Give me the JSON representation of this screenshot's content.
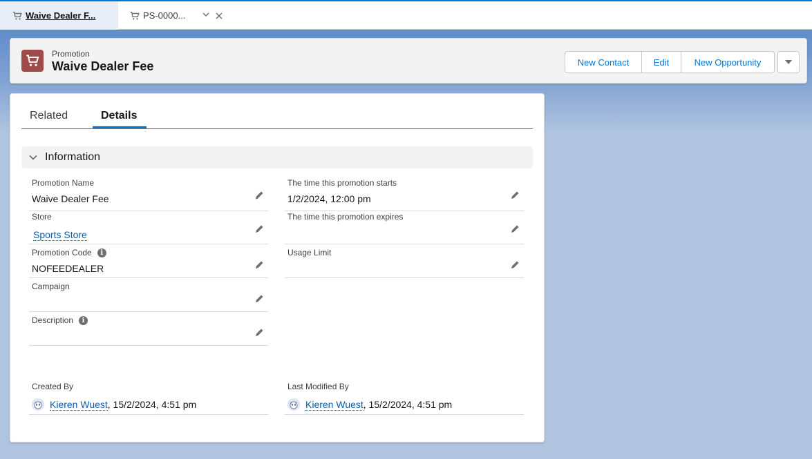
{
  "tabs": [
    {
      "label": "Waive Dealer F..."
    },
    {
      "label": "PS-0000..."
    }
  ],
  "header": {
    "object_type": "Promotion",
    "record_name": "Waive Dealer Fee",
    "buttons": {
      "new_contact": "New Contact",
      "edit": "Edit",
      "new_opportunity": "New Opportunity"
    }
  },
  "record_tabs": {
    "related": "Related",
    "details": "Details"
  },
  "section": {
    "title": "Information"
  },
  "fields": {
    "promotion_name": {
      "label": "Promotion Name",
      "value": "Waive Dealer Fee"
    },
    "starts": {
      "label": "The time this promotion starts",
      "value": "1/2/2024, 12:00 pm"
    },
    "store": {
      "label": "Store",
      "value": "Sports Store"
    },
    "expires": {
      "label": "The time this promotion expires",
      "value": ""
    },
    "promotion_code": {
      "label": "Promotion Code",
      "value": "NOFEEDEALER"
    },
    "usage_limit": {
      "label": "Usage Limit",
      "value": ""
    },
    "campaign": {
      "label": "Campaign",
      "value": ""
    },
    "description": {
      "label": "Description",
      "value": ""
    },
    "created_by": {
      "label": "Created By",
      "user": "Kieren Wuest",
      "date": ", 15/2/2024, 4:51 pm"
    },
    "last_modified_by": {
      "label": "Last Modified By",
      "user": "Kieren Wuest",
      "date": ", 15/2/2024, 4:51 pm"
    }
  },
  "colors": {
    "brand": "#0176d3",
    "object_icon": "#a04b49",
    "link": "#0b5cab"
  }
}
